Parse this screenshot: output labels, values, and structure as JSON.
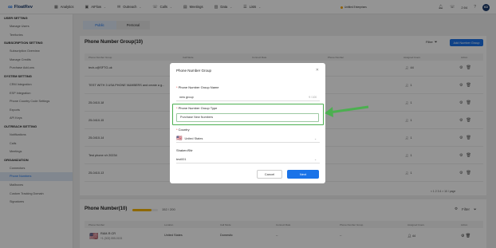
{
  "app": {
    "logo_text": "FloatRev"
  },
  "nav": [
    {
      "icon": "chart-icon",
      "glyph": "▦",
      "label": "Analytics",
      "dropdown": false
    },
    {
      "icon": "ai-icon",
      "glyph": "▣",
      "label": "AIFlow",
      "dropdown": true
    },
    {
      "icon": "outreach-icon",
      "glyph": "✉",
      "label": "Outreach",
      "dropdown": true
    },
    {
      "icon": "phone-icon",
      "glyph": "☏",
      "label": "Calls",
      "dropdown": true
    },
    {
      "icon": "calendar-icon",
      "glyph": "▤",
      "label": "Meetings",
      "dropdown": false
    },
    {
      "icon": "data-icon",
      "glyph": "▥",
      "label": "Data",
      "dropdown": true
    },
    {
      "icon": "list-icon",
      "glyph": "☰",
      "label": "Lists",
      "dropdown": true
    }
  ],
  "topright": {
    "tenant": "Untitled Enterprises",
    "timer": "2:04",
    "avatar": "KD"
  },
  "sidebar": [
    {
      "type": "section",
      "label": "USER SETTING"
    },
    {
      "type": "item",
      "label": "Manage Users"
    },
    {
      "type": "item",
      "label": "Territories"
    },
    {
      "type": "section",
      "label": "SUBSCRIPTION SETTING"
    },
    {
      "type": "item",
      "label": "Subscription Overview"
    },
    {
      "type": "item",
      "label": "Manage Credits"
    },
    {
      "type": "item",
      "label": "Purchase Add-ons"
    },
    {
      "type": "section",
      "label": "SYSTEM SETTING"
    },
    {
      "type": "item",
      "label": "CRM Integration"
    },
    {
      "type": "item",
      "label": "ESP Integration"
    },
    {
      "type": "item",
      "label": "Phone Country Code Settings"
    },
    {
      "type": "item",
      "label": "Exports"
    },
    {
      "type": "item",
      "label": "API Keys"
    },
    {
      "type": "section",
      "label": "OUTREACH SETTING"
    },
    {
      "type": "item",
      "label": "Notifications"
    },
    {
      "type": "item",
      "label": "Calls"
    },
    {
      "type": "item",
      "label": "Meetings"
    },
    {
      "type": "section",
      "label": "ORGANIZATION"
    },
    {
      "type": "item",
      "label": "Connectors"
    },
    {
      "type": "item",
      "label": "Phone Numbers",
      "active": true
    },
    {
      "type": "item",
      "label": "Mailboxes"
    },
    {
      "type": "item",
      "label": "Custom Tracking Domain"
    },
    {
      "type": "item",
      "label": "Signatures"
    }
  ],
  "tabs": [
    "Public",
    "Personal"
  ],
  "group_table": {
    "title": "Phone Number Group(10)",
    "filter_label": "Filter",
    "add_button": "Add Number Group",
    "columns": [
      "Phone Number Group",
      "Call Mode",
      "Connect Rate",
      "Phone Number",
      "Assigned Users",
      "Action"
    ],
    "rows": [
      {
        "name": "tech-c@SFTG-uk",
        "users": "44"
      },
      {
        "name": "TEST WITH 3 USA PHONE NUMBERS and create a g...",
        "users": "1"
      },
      {
        "name": "25-0410-18",
        "users": "1"
      },
      {
        "name": "25-0410-15",
        "users": "1"
      },
      {
        "name": "25-0410-14",
        "users": "1"
      },
      {
        "name": "Test phone n/r 20234",
        "users": "1"
      },
      {
        "name": "25-0410-13",
        "users": "1"
      }
    ],
    "pager": "< 1 2 3 4 >    10 / page"
  },
  "number_table": {
    "title": "Phone Number(10)",
    "progress_label": "152 / 200",
    "progress": 0.76,
    "filter_label": "Filter",
    "columns": [
      "Phone Number",
      "Location",
      "Call Mode",
      "Connect Rate",
      "Phone Number Group",
      "Assigned Users",
      "Action"
    ],
    "row": {
      "flag": "🇺🇸",
      "name": "RAM-R.CR",
      "number": "+1 (302) 555-0133",
      "location": "United States",
      "mode": "Domestic",
      "rate": "--",
      "group": "--",
      "users": "44"
    }
  },
  "modal": {
    "title": "Phone Number Group",
    "name_label": "Phone Number Group Name",
    "name_value": "new group",
    "name_count": "9 / 100",
    "type_label": "Phone Number Group Type",
    "type_value": "Purchase New Numbers",
    "country_label": "Country",
    "country_flag": "🇺🇸",
    "country_value": "United States",
    "shaken_label": "Shaken/Stir",
    "shaken_value": "test001",
    "cancel": "Cancel",
    "next": "Next"
  },
  "colors": {
    "primary": "#1a73e8",
    "highlight": "#4caf50",
    "progress": "#f4b400"
  }
}
